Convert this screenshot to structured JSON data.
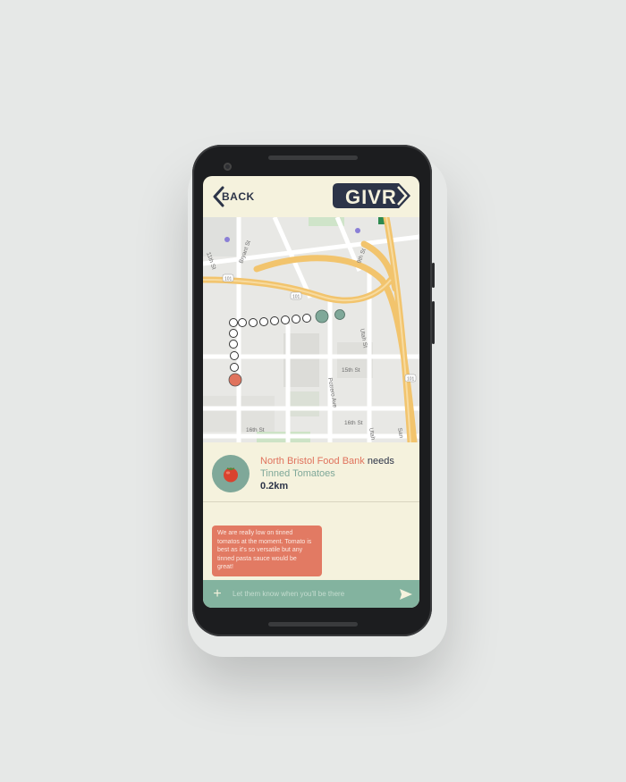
{
  "header": {
    "back_label": "BACK",
    "logo_text": "GIVR"
  },
  "map": {
    "street_labels": [
      "11th St",
      "Bryant St",
      "9th St",
      "15th St",
      "Potrero Ave",
      "Utah St",
      "16th St",
      "16th St",
      "Utah",
      "San"
    ],
    "highway_shields": [
      "101",
      "101",
      "101"
    ],
    "route_color": "#7fa899",
    "destination_color": "#e0735d"
  },
  "listing": {
    "organization": "North Bristol Food Bank",
    "verb": "needs",
    "item": "Tinned Tomatoes",
    "distance": "0.2km",
    "icon": "tomato-icon"
  },
  "chat": {
    "message": "We are really low on tinned tomatos at the moment. Tomato is best as it's so versatile but any tinned pasta sauce would be great!"
  },
  "composer": {
    "placeholder": "Let them know when you'll be there",
    "add_icon": "plus-icon",
    "send_icon": "send-icon"
  },
  "colors": {
    "background": "#f5f2dd",
    "accent_red": "#e0735d",
    "accent_green": "#7fa899",
    "navy": "#2c3448"
  }
}
